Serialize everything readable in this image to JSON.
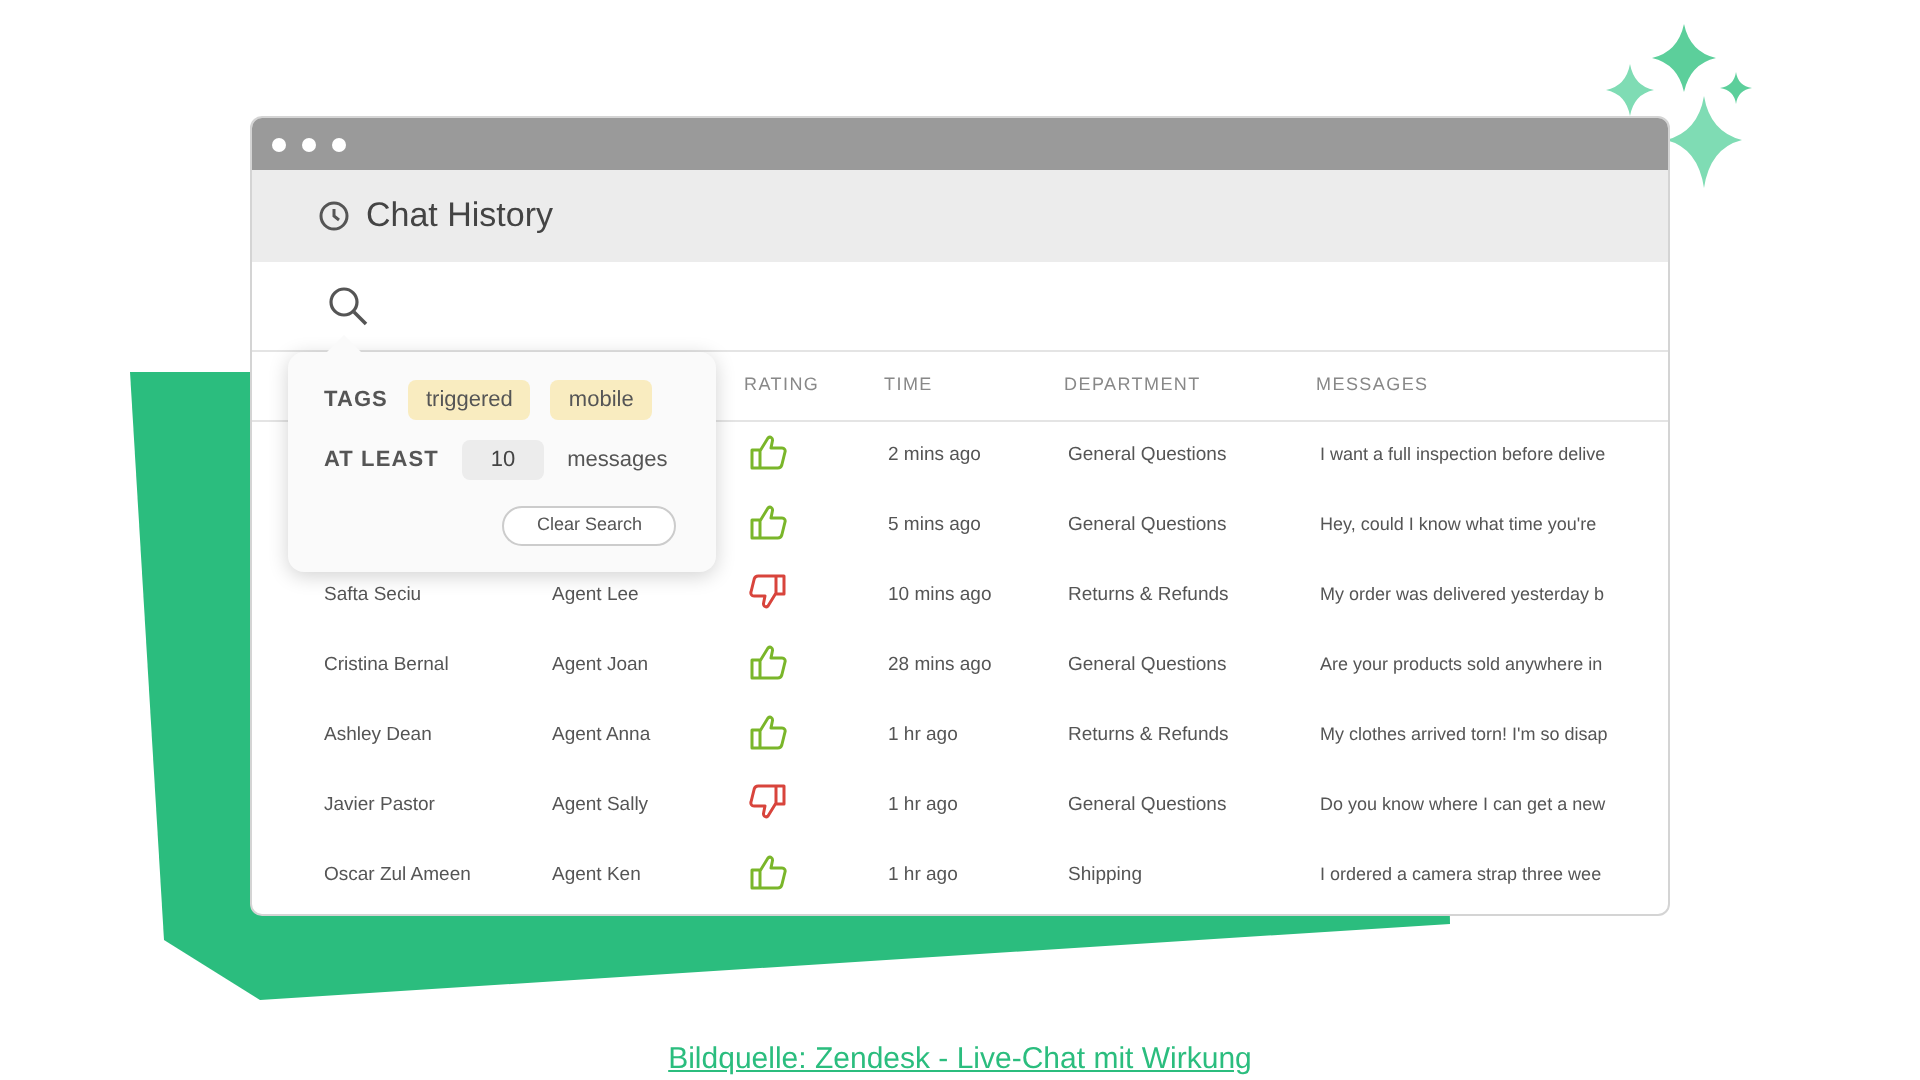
{
  "window": {
    "title": "Chat History"
  },
  "search_popover": {
    "tags_label": "TAGS",
    "tags": [
      "triggered",
      "mobile"
    ],
    "min_label": "AT LEAST",
    "min_value": "10",
    "min_unit": "messages",
    "clear_button": "Clear Search"
  },
  "table": {
    "columns": [
      "RATING",
      "TIME",
      "DEPARTMENT",
      "MESSAGES"
    ],
    "rows": [
      {
        "thumbs_up": true,
        "time": "2 mins ago",
        "department": "General Questions",
        "message": "I want a full inspection before delive"
      },
      {
        "thumbs_up": true,
        "time": "5 mins ago",
        "department": "General Questions",
        "message": "Hey, could I know what time you're"
      },
      {
        "name": "Safta Seciu",
        "agent": "Agent Lee",
        "thumbs_up": false,
        "time": "10 mins ago",
        "department": "Returns & Refunds",
        "message": "My order was delivered yesterday b"
      },
      {
        "name": "Cristina Bernal",
        "agent": "Agent Joan",
        "thumbs_up": true,
        "time": "28 mins ago",
        "department": "General Questions",
        "message": "Are your products sold anywhere in"
      },
      {
        "name": "Ashley Dean",
        "agent": "Agent Anna",
        "thumbs_up": true,
        "time": "1 hr ago",
        "department": "Returns & Refunds",
        "message": "My clothes arrived torn! I'm so disap"
      },
      {
        "name": "Javier Pastor",
        "agent": "Agent Sally",
        "thumbs_up": false,
        "time": "1 hr ago",
        "department": "General Questions",
        "message": "Do you know where I can get a new"
      },
      {
        "name": "Oscar Zul Ameen",
        "agent": "Agent Ken",
        "thumbs_up": true,
        "time": "1 hr ago",
        "department": "Shipping",
        "message": "I ordered a camera strap three wee"
      }
    ]
  },
  "caption": "Bildquelle: Zendesk - Live-Chat mit Wirkung"
}
